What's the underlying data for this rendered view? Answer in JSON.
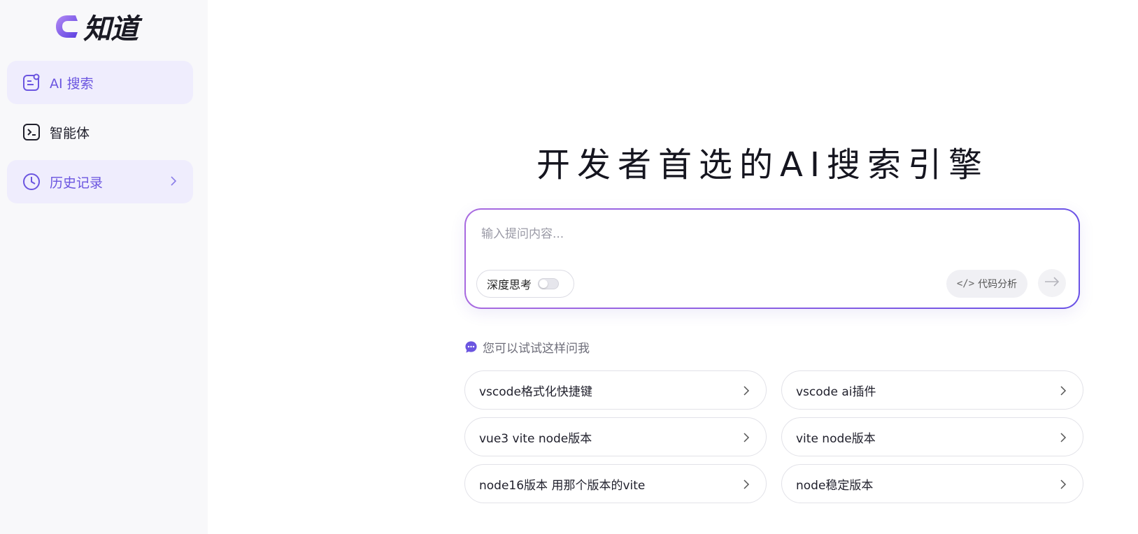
{
  "brand": {
    "name": "知道"
  },
  "sidebar": {
    "items": [
      {
        "label": "AI 搜索",
        "icon": "ai-search-icon"
      },
      {
        "label": "智能体",
        "icon": "terminal-icon"
      },
      {
        "label": "历史记录",
        "icon": "clock-icon"
      }
    ]
  },
  "main": {
    "headline": "开发者首选的AI搜索引擎",
    "input": {
      "placeholder": "输入提问内容...",
      "value": ""
    },
    "deep_think": {
      "label": "深度思考",
      "enabled": false
    },
    "code_analysis": {
      "label": "代码分析",
      "glyph": "</>"
    },
    "suggestions": {
      "title": "您可以试试这样问我",
      "items": [
        "vscode格式化快捷键",
        "vscode ai插件",
        "vue3 vite node版本",
        "vite node版本",
        "node16版本 用那个版本的vite",
        "node稳定版本"
      ]
    }
  },
  "colors": {
    "accent": "#6b55e0",
    "accent_bg": "#efedfd",
    "gradient_start": "#a86ae0",
    "gradient_end": "#6a52e6"
  }
}
